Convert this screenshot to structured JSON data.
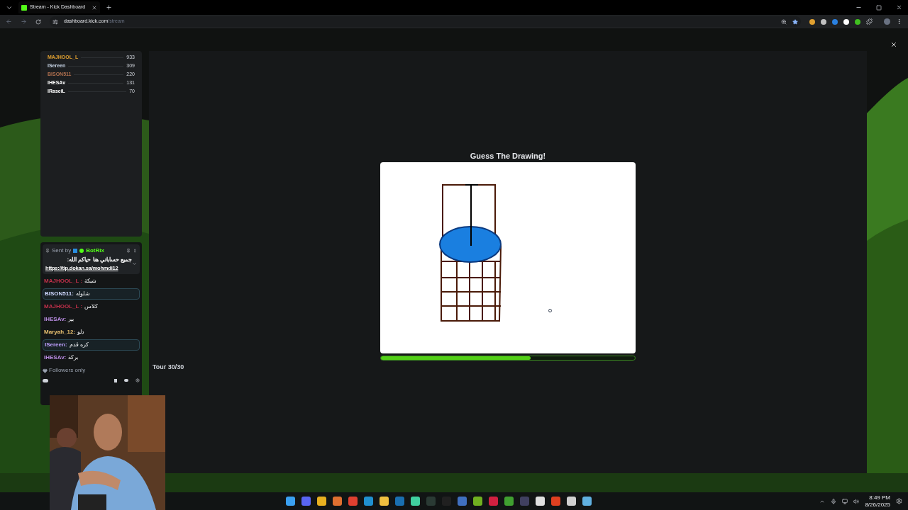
{
  "browser": {
    "tab_title": "Stream - Kick Dashboard",
    "url_host": "dashboard.kick.com",
    "url_path": "/stream"
  },
  "leaderboard": [
    {
      "name": "MAJHOOL_L",
      "score": "933",
      "color": "#e0a030"
    },
    {
      "name": "ISereen",
      "score": "309",
      "color": "#c9d6e8"
    },
    {
      "name": "BISON511",
      "score": "220",
      "color": "#b0704f"
    },
    {
      "name": "IHESAv",
      "score": "131",
      "color": "#ffffff"
    },
    {
      "name": "IRaseiL",
      "score": "70",
      "color": "#ffffff"
    }
  ],
  "chat": {
    "pinned": {
      "sent_by": "Sent by",
      "sender": "BotRix",
      "message": "جميع حساباتي هنا حياكم الله:",
      "link": "https://tip.dokan.sa/mohmdi12"
    },
    "messages": [
      {
        "user": "MAJHOOL_L :",
        "text": "شبكة",
        "color": "#c0304a",
        "highlighted": false
      },
      {
        "user": "BISON511:",
        "text": "شلوله",
        "color": "#cfd8ff",
        "highlighted": true
      },
      {
        "user": "MAJHOOL_L :",
        "text": "كلاس",
        "color": "#c0304a",
        "highlighted": false
      },
      {
        "user": "IHESAv:",
        "text": "بير",
        "color": "#b88be0",
        "highlighted": false
      },
      {
        "user": "Maryah_12:",
        "text": "دلو",
        "color": "#e8c070",
        "highlighted": false
      },
      {
        "user": "ISereen:",
        "text": "كره قدم",
        "color": "#c0a0ff",
        "highlighted": true
      },
      {
        "user": "IHESAv:",
        "text": "بركة",
        "color": "#b88be0",
        "highlighted": false
      }
    ],
    "mode": "Followers only"
  },
  "game": {
    "title": "Guess The Drawing!",
    "tour": "Tour 30/30",
    "level": 0.59
  },
  "taskbar": {
    "time": "8:49 PM",
    "date": "8/26/2025"
  }
}
